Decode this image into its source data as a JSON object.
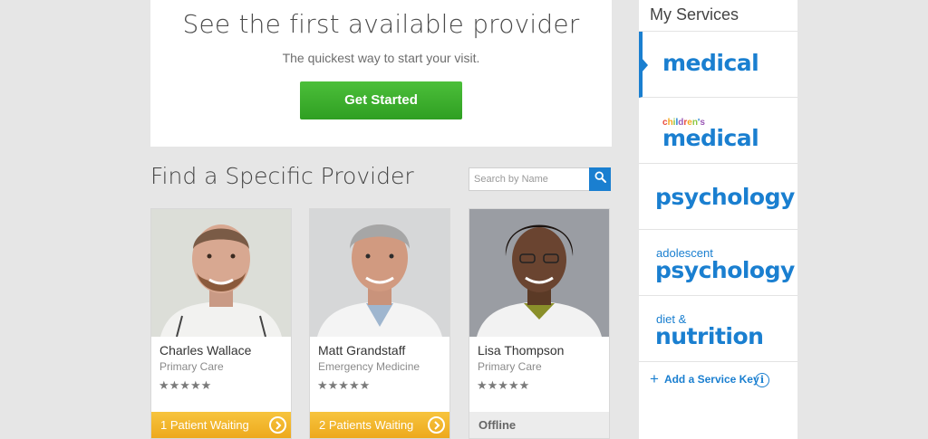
{
  "hero": {
    "title": "See the first available provider",
    "subtitle": "The quickest way to start your visit.",
    "button_label": "Get Started",
    "button_color": "#36a82a"
  },
  "find": {
    "title": "Find a Specific Provider",
    "search_placeholder": "Search by Name",
    "search_icon": "search-icon"
  },
  "providers": [
    {
      "name": "Charles Wallace",
      "specialty": "Primary Care",
      "rating_stars": "★★★★★",
      "rating": 5,
      "status": "1 Patient Waiting",
      "status_type": "waiting"
    },
    {
      "name": "Matt Grandstaff",
      "specialty": "Emergency Medicine",
      "rating_stars": "★★★★★",
      "rating": 5,
      "status": "2 Patients Waiting",
      "status_type": "waiting"
    },
    {
      "name": "Lisa Thompson",
      "specialty": "Primary Care",
      "rating_stars": "★★★★★",
      "rating": 5,
      "status": "Offline",
      "status_type": "offline"
    }
  ],
  "services": {
    "title": "My Services",
    "items": [
      {
        "small": "",
        "big": "medical",
        "active": true
      },
      {
        "small": "children's",
        "big": "medical",
        "active": false
      },
      {
        "small": "",
        "big": "psychology",
        "active": false
      },
      {
        "small": "adolescent",
        "big": "psychology",
        "active": false
      },
      {
        "small": "diet &",
        "big": "nutrition",
        "active": false
      }
    ],
    "add_key_label": "Add a Service Key",
    "info_label": "i",
    "accent_color": "#1a7fd0"
  },
  "colors": {
    "waiting": "#f0b02a",
    "offline": "#ececec",
    "accent": "#1a7fd0",
    "children_letters": [
      "#e94b3c",
      "#f4a81d",
      "#8cc63f",
      "#1a7fd0",
      "#9b59b6",
      "#e94b3c",
      "#f4a81d",
      "#8cc63f",
      "#1a7fd0",
      "#9b59b6"
    ]
  }
}
